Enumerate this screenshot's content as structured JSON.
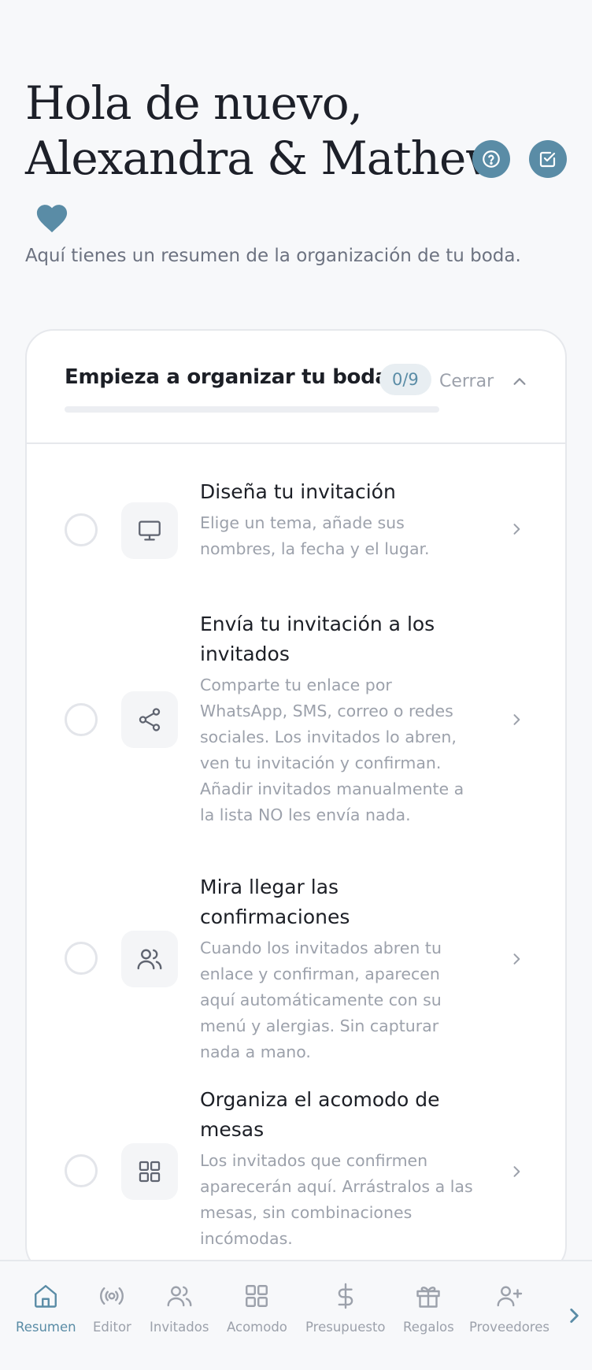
{
  "hero": {
    "title_line1": "Hola de nuevo,",
    "title_line2": "Alexandra & Mathew",
    "subtitle": "Aquí tienes un resumen de la organización de tu boda.",
    "accent": "#5a8ca6"
  },
  "checklist": {
    "title": "Empieza a organizar tu boda",
    "count": "0/9",
    "progress": 0,
    "close_label": "Cerrar",
    "tasks": [
      {
        "title": "Diseña tu invitación",
        "description": "Elige un tema, añade sus nombres, la fecha y el lugar.",
        "icon": "monitor-icon"
      },
      {
        "title": "Envía tu invitación a los invitados",
        "description": "Comparte tu enlace por WhatsApp, SMS, correo o redes sociales. Los invitados lo abren, ven tu invitación y confirman. Añadir invitados manualmente a la lista NO les envía nada.",
        "icon": "share-icon"
      },
      {
        "title": "Mira llegar las confirmaciones",
        "description": "Cuando los invitados abren tu enlace y confirman, aparecen aquí automáticamente con su menú y alergias. Sin capturar nada a mano.",
        "icon": "users-icon"
      },
      {
        "title": "Organiza el acomodo de mesas",
        "description": "Los invitados que confirmen aparecerán aquí. Arrástralos a las mesas, sin combinaciones incómodas.",
        "icon": "grid-icon"
      }
    ]
  },
  "nav": {
    "items": [
      {
        "label": "Resumen",
        "icon": "home-icon",
        "active": true
      },
      {
        "label": "Editor",
        "icon": "broadcast-icon"
      },
      {
        "label": "Invitados",
        "icon": "users-icon"
      },
      {
        "label": "Acomodo",
        "icon": "grid-icon"
      },
      {
        "label": "Presupuesto",
        "icon": "dollar-icon"
      },
      {
        "label": "Regalos",
        "icon": "gift-icon"
      },
      {
        "label": "Proveedores",
        "icon": "user-plus-icon"
      }
    ]
  }
}
